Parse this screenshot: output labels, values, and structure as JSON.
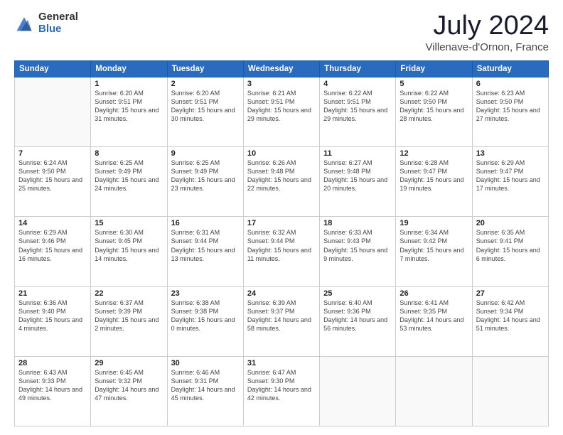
{
  "header": {
    "logo": {
      "general": "General",
      "blue": "Blue"
    },
    "title": "July 2024",
    "location": "Villenave-d'Ornon, France"
  },
  "weekdays": [
    "Sunday",
    "Monday",
    "Tuesday",
    "Wednesday",
    "Thursday",
    "Friday",
    "Saturday"
  ],
  "weeks": [
    [
      {
        "day": "",
        "sunrise": "",
        "sunset": "",
        "daylight": ""
      },
      {
        "day": "1",
        "sunrise": "Sunrise: 6:20 AM",
        "sunset": "Sunset: 9:51 PM",
        "daylight": "Daylight: 15 hours and 31 minutes."
      },
      {
        "day": "2",
        "sunrise": "Sunrise: 6:20 AM",
        "sunset": "Sunset: 9:51 PM",
        "daylight": "Daylight: 15 hours and 30 minutes."
      },
      {
        "day": "3",
        "sunrise": "Sunrise: 6:21 AM",
        "sunset": "Sunset: 9:51 PM",
        "daylight": "Daylight: 15 hours and 29 minutes."
      },
      {
        "day": "4",
        "sunrise": "Sunrise: 6:22 AM",
        "sunset": "Sunset: 9:51 PM",
        "daylight": "Daylight: 15 hours and 29 minutes."
      },
      {
        "day": "5",
        "sunrise": "Sunrise: 6:22 AM",
        "sunset": "Sunset: 9:50 PM",
        "daylight": "Daylight: 15 hours and 28 minutes."
      },
      {
        "day": "6",
        "sunrise": "Sunrise: 6:23 AM",
        "sunset": "Sunset: 9:50 PM",
        "daylight": "Daylight: 15 hours and 27 minutes."
      }
    ],
    [
      {
        "day": "7",
        "sunrise": "Sunrise: 6:24 AM",
        "sunset": "Sunset: 9:50 PM",
        "daylight": "Daylight: 15 hours and 25 minutes."
      },
      {
        "day": "8",
        "sunrise": "Sunrise: 6:25 AM",
        "sunset": "Sunset: 9:49 PM",
        "daylight": "Daylight: 15 hours and 24 minutes."
      },
      {
        "day": "9",
        "sunrise": "Sunrise: 6:25 AM",
        "sunset": "Sunset: 9:49 PM",
        "daylight": "Daylight: 15 hours and 23 minutes."
      },
      {
        "day": "10",
        "sunrise": "Sunrise: 6:26 AM",
        "sunset": "Sunset: 9:48 PM",
        "daylight": "Daylight: 15 hours and 22 minutes."
      },
      {
        "day": "11",
        "sunrise": "Sunrise: 6:27 AM",
        "sunset": "Sunset: 9:48 PM",
        "daylight": "Daylight: 15 hours and 20 minutes."
      },
      {
        "day": "12",
        "sunrise": "Sunrise: 6:28 AM",
        "sunset": "Sunset: 9:47 PM",
        "daylight": "Daylight: 15 hours and 19 minutes."
      },
      {
        "day": "13",
        "sunrise": "Sunrise: 6:29 AM",
        "sunset": "Sunset: 9:47 PM",
        "daylight": "Daylight: 15 hours and 17 minutes."
      }
    ],
    [
      {
        "day": "14",
        "sunrise": "Sunrise: 6:29 AM",
        "sunset": "Sunset: 9:46 PM",
        "daylight": "Daylight: 15 hours and 16 minutes."
      },
      {
        "day": "15",
        "sunrise": "Sunrise: 6:30 AM",
        "sunset": "Sunset: 9:45 PM",
        "daylight": "Daylight: 15 hours and 14 minutes."
      },
      {
        "day": "16",
        "sunrise": "Sunrise: 6:31 AM",
        "sunset": "Sunset: 9:44 PM",
        "daylight": "Daylight: 15 hours and 13 minutes."
      },
      {
        "day": "17",
        "sunrise": "Sunrise: 6:32 AM",
        "sunset": "Sunset: 9:44 PM",
        "daylight": "Daylight: 15 hours and 11 minutes."
      },
      {
        "day": "18",
        "sunrise": "Sunrise: 6:33 AM",
        "sunset": "Sunset: 9:43 PM",
        "daylight": "Daylight: 15 hours and 9 minutes."
      },
      {
        "day": "19",
        "sunrise": "Sunrise: 6:34 AM",
        "sunset": "Sunset: 9:42 PM",
        "daylight": "Daylight: 15 hours and 7 minutes."
      },
      {
        "day": "20",
        "sunrise": "Sunrise: 6:35 AM",
        "sunset": "Sunset: 9:41 PM",
        "daylight": "Daylight: 15 hours and 6 minutes."
      }
    ],
    [
      {
        "day": "21",
        "sunrise": "Sunrise: 6:36 AM",
        "sunset": "Sunset: 9:40 PM",
        "daylight": "Daylight: 15 hours and 4 minutes."
      },
      {
        "day": "22",
        "sunrise": "Sunrise: 6:37 AM",
        "sunset": "Sunset: 9:39 PM",
        "daylight": "Daylight: 15 hours and 2 minutes."
      },
      {
        "day": "23",
        "sunrise": "Sunrise: 6:38 AM",
        "sunset": "Sunset: 9:38 PM",
        "daylight": "Daylight: 15 hours and 0 minutes."
      },
      {
        "day": "24",
        "sunrise": "Sunrise: 6:39 AM",
        "sunset": "Sunset: 9:37 PM",
        "daylight": "Daylight: 14 hours and 58 minutes."
      },
      {
        "day": "25",
        "sunrise": "Sunrise: 6:40 AM",
        "sunset": "Sunset: 9:36 PM",
        "daylight": "Daylight: 14 hours and 56 minutes."
      },
      {
        "day": "26",
        "sunrise": "Sunrise: 6:41 AM",
        "sunset": "Sunset: 9:35 PM",
        "daylight": "Daylight: 14 hours and 53 minutes."
      },
      {
        "day": "27",
        "sunrise": "Sunrise: 6:42 AM",
        "sunset": "Sunset: 9:34 PM",
        "daylight": "Daylight: 14 hours and 51 minutes."
      }
    ],
    [
      {
        "day": "28",
        "sunrise": "Sunrise: 6:43 AM",
        "sunset": "Sunset: 9:33 PM",
        "daylight": "Daylight: 14 hours and 49 minutes."
      },
      {
        "day": "29",
        "sunrise": "Sunrise: 6:45 AM",
        "sunset": "Sunset: 9:32 PM",
        "daylight": "Daylight: 14 hours and 47 minutes."
      },
      {
        "day": "30",
        "sunrise": "Sunrise: 6:46 AM",
        "sunset": "Sunset: 9:31 PM",
        "daylight": "Daylight: 14 hours and 45 minutes."
      },
      {
        "day": "31",
        "sunrise": "Sunrise: 6:47 AM",
        "sunset": "Sunset: 9:30 PM",
        "daylight": "Daylight: 14 hours and 42 minutes."
      },
      {
        "day": "",
        "sunrise": "",
        "sunset": "",
        "daylight": ""
      },
      {
        "day": "",
        "sunrise": "",
        "sunset": "",
        "daylight": ""
      },
      {
        "day": "",
        "sunrise": "",
        "sunset": "",
        "daylight": ""
      }
    ]
  ]
}
